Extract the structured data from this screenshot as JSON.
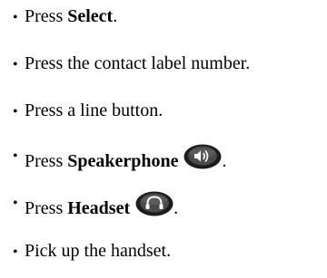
{
  "steps": [
    {
      "prefix": "Press ",
      "bold": "Select",
      "suffix": "."
    },
    {
      "text": "Press the contact label number."
    },
    {
      "text": "Press a line button."
    },
    {
      "prefix": "Press ",
      "bold": "Speakerphone",
      "suffix": ".",
      "icon": "speakerphone-icon"
    },
    {
      "prefix": "Press ",
      "bold": "Headset",
      "suffix": ".",
      "icon": "headset-icon"
    },
    {
      "text": "Pick up the handset."
    }
  ],
  "colors": {
    "text": "#000000",
    "button_outer": "#1c1c1c",
    "button_inner": "#4a4a4a",
    "button_glyph": "#ffffff"
  }
}
